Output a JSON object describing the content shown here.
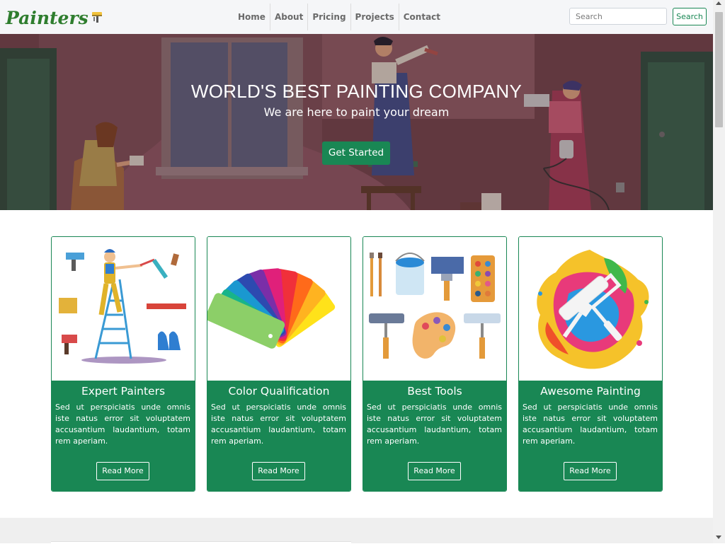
{
  "navbar": {
    "brand": "Painters",
    "links": [
      "Home",
      "About",
      "Pricing",
      "Projects",
      "Contact"
    ],
    "search_placeholder": "Search",
    "search_button": "Search"
  },
  "hero": {
    "title": "WORLD'S BEST PAINTING COMPANY",
    "subtitle": "We are here to paint your dream",
    "cta": "Get Started"
  },
  "cards": [
    {
      "title": "Expert Painters",
      "text": "Sed ut perspiciatis unde omnis iste natus error sit voluptatem accusantium laudantium, totam rem aperiam.",
      "button": "Read More",
      "image_icon": "painter-on-ladder-illustration"
    },
    {
      "title": "Color Qualification",
      "text": "Sed ut perspiciatis unde omnis iste natus error sit voluptatem accusantium laudantium, totam rem aperiam.",
      "button": "Read More",
      "image_icon": "color-swatch-fan-illustration"
    },
    {
      "title": "Best Tools",
      "text": "Sed ut perspiciatis unde omnis iste natus error sit voluptatem accusantium laudantium, totam rem aperiam.",
      "button": "Read More",
      "image_icon": "painting-tools-illustration"
    },
    {
      "title": "Awesome Painting",
      "text": "Sed ut perspiciatis unde omnis iste natus error sit voluptatem accusantium laudantium, totam rem aperiam.",
      "button": "Read More",
      "image_icon": "paint-splash-roller-illustration"
    }
  ],
  "colors": {
    "accent_green": "#198754",
    "brand_green": "#2e7d2e",
    "navbar_bg": "#f5f6f8",
    "hero_overlay": "#7b4a52"
  }
}
